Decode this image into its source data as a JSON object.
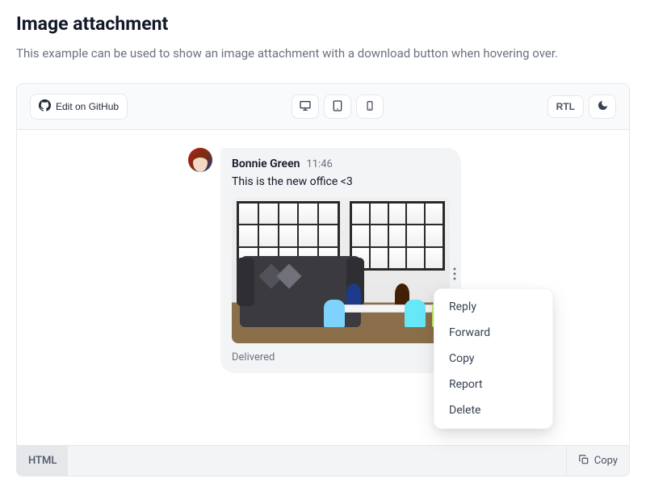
{
  "page": {
    "title": "Image attachment",
    "description": "This example can be used to show an image attachment with a download button when hovering over."
  },
  "toolbar": {
    "edit_github": "Edit on GitHub",
    "rtl": "RTL"
  },
  "chat": {
    "sender_name": "Bonnie Green",
    "time": "11:46",
    "message": "This is the new office <3",
    "status": "Delivered"
  },
  "dropdown": {
    "items": [
      "Reply",
      "Forward",
      "Copy",
      "Report",
      "Delete"
    ]
  },
  "code_bar": {
    "tab": "HTML",
    "copy": "Copy"
  }
}
